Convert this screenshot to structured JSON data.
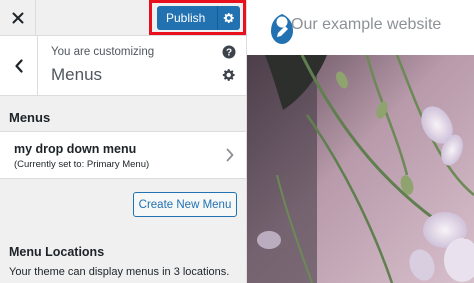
{
  "toolbar": {
    "close_icon": "close-icon",
    "publish_label": "Publish",
    "publish_gear_icon": "gear-icon",
    "highlight_color": "#e8101c",
    "primary_color": "#2271b1"
  },
  "section": {
    "customizing_label": "You are customizing",
    "title": "Menus",
    "back_icon": "chevron-left-icon",
    "help_icon": "help-icon",
    "settings_icon": "gear-icon"
  },
  "menus": {
    "heading": "Menus",
    "items": [
      {
        "name": "my drop down menu",
        "subtitle": "(Currently set to: Primary Menu)"
      }
    ],
    "create_button": "Create New Menu"
  },
  "locations": {
    "heading": "Menu Locations",
    "text": "Your theme can display menus in 3 locations."
  },
  "preview": {
    "site_title": "Our example website",
    "logo_icon": "pencil-logo-icon"
  }
}
